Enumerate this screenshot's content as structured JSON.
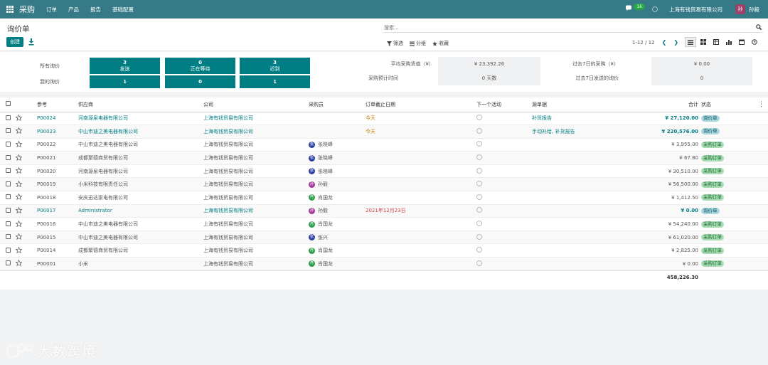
{
  "nav": {
    "app_name": "采购",
    "menu": [
      "订单",
      "产品",
      "报告",
      "基础配置"
    ],
    "chat_count": "16",
    "company": "上海有钱贸易有限公司",
    "user_initial": "孙",
    "user_name": "孙毅"
  },
  "control": {
    "title": "询价单",
    "create_label": "创建",
    "search_placeholder": "搜索...",
    "filters_label": "筛选",
    "groupby_label": "分组",
    "favorites_label": "收藏",
    "pager": "1-12 / 12"
  },
  "dashboard": {
    "all_rfqs_label": "所有询价",
    "my_rfqs_label": "我的询价",
    "tiles": [
      {
        "top": "3",
        "label": "发送",
        "bottom": "1"
      },
      {
        "top": "0",
        "label": "正在等待",
        "bottom": "0"
      },
      {
        "top": "3",
        "label": "迟到",
        "bottom": "1"
      }
    ],
    "stats": {
      "avg_order_label": "平均采购货值（¥）",
      "avg_order_value": "¥ 23,392.26",
      "lead_time_label": "采购预计时间",
      "lead_time_value": "0 天数",
      "last7_purchase_label": "过去7日的采购（¥）",
      "last7_purchase_value": "¥ 0.00",
      "last7_rfq_label": "过去7日发送的询价",
      "last7_rfq_value": "0"
    }
  },
  "table": {
    "headers": {
      "ref": "参考",
      "vendor": "供应商",
      "company": "公司",
      "buyer": "采购员",
      "deadline": "订单截止日期",
      "activity": "下一个活动",
      "source": "源单据",
      "total": "合计",
      "status": "状态"
    },
    "rows": [
      {
        "ref": "P00024",
        "vendor": "河南源泉电器有限公司",
        "company": "上海有钱贸易有限公司",
        "buyer": "",
        "buyer_initial": "",
        "deadline": "今天",
        "source": "补货报告",
        "total": "¥ 27,120.00",
        "status": "询价单"
      },
      {
        "ref": "P00023",
        "vendor": "中山市迪之美电器有限公司",
        "company": "上海有钱贸易有限公司",
        "buyer": "",
        "buyer_initial": "",
        "deadline": "今天",
        "source": "手动补给, 补货报告",
        "total": "¥ 220,576.00",
        "status": "询价单"
      },
      {
        "ref": "P00022",
        "vendor": "中山市迪之美电器有限公司",
        "company": "上海有钱贸易有限公司",
        "buyer": "张晓峰",
        "buyer_initial": "张",
        "deadline": "",
        "source": "",
        "total": "¥ 3,955.00",
        "status": "采购订单"
      },
      {
        "ref": "P00021",
        "vendor": "成都聚德商贸有限公司",
        "company": "上海有钱贸易有限公司",
        "buyer": "张晓峰",
        "buyer_initial": "张",
        "deadline": "",
        "source": "",
        "total": "¥ 67.80",
        "status": "采购订单"
      },
      {
        "ref": "P00020",
        "vendor": "河南源泉电器有限公司",
        "company": "上海有钱贸易有限公司",
        "buyer": "张晓峰",
        "buyer_initial": "张",
        "deadline": "",
        "source": "",
        "total": "¥ 30,510.00",
        "status": "采购订单"
      },
      {
        "ref": "P00019",
        "vendor": "小米科技有限责任公司",
        "company": "上海有钱贸易有限公司",
        "buyer": "孙毅",
        "buyer_initial": "孙",
        "deadline": "",
        "source": "",
        "total": "¥ 56,500.00",
        "status": "采购订单"
      },
      {
        "ref": "P00018",
        "vendor": "安庆迅达家电有限公司",
        "company": "上海有钱贸易有限公司",
        "buyer": "肖国龙",
        "buyer_initial": "肖",
        "deadline": "",
        "source": "",
        "total": "¥ 1,412.50",
        "status": "采购订单"
      },
      {
        "ref": "P00017",
        "vendor": "Administrator",
        "company": "上海有钱贸易有限公司",
        "buyer": "孙毅",
        "buyer_initial": "孙",
        "deadline": "2021年12月23日",
        "source": "",
        "total": "¥ 0.00",
        "status": "询价单"
      },
      {
        "ref": "P00016",
        "vendor": "中山市迪之美电器有限公司",
        "company": "上海有钱贸易有限公司",
        "buyer": "肖国龙",
        "buyer_initial": "肖",
        "deadline": "",
        "source": "",
        "total": "¥ 54,240.00",
        "status": "采购订单"
      },
      {
        "ref": "P00015",
        "vendor": "中山市迪之美电器有限公司",
        "company": "上海有钱贸易有限公司",
        "buyer": "张兴",
        "buyer_initial": "张",
        "deadline": "",
        "source": "",
        "total": "¥ 61,020.00",
        "status": "采购订单"
      },
      {
        "ref": "P00014",
        "vendor": "成都聚德商贸有限公司",
        "company": "上海有钱贸易有限公司",
        "buyer": "肖国龙",
        "buyer_initial": "肖",
        "deadline": "",
        "source": "",
        "total": "¥ 2,825.00",
        "status": "采购订单"
      },
      {
        "ref": "P00001",
        "vendor": "小米",
        "company": "上海有钱贸易有限公司",
        "buyer": "肖国龙",
        "buyer_initial": "肖",
        "deadline": "",
        "source": "",
        "total": "¥ 0.00",
        "status": "采购订单"
      }
    ],
    "sum_total": "458,226.30"
  },
  "watermark": "大数跨境",
  "colors": {
    "nav_bg": "#367a87",
    "primary": "#017e84",
    "rfq_badge": "#a9d7dd",
    "po_badge": "#a8dcb4",
    "orange": "#c47c00",
    "red": "#d23f3a"
  }
}
